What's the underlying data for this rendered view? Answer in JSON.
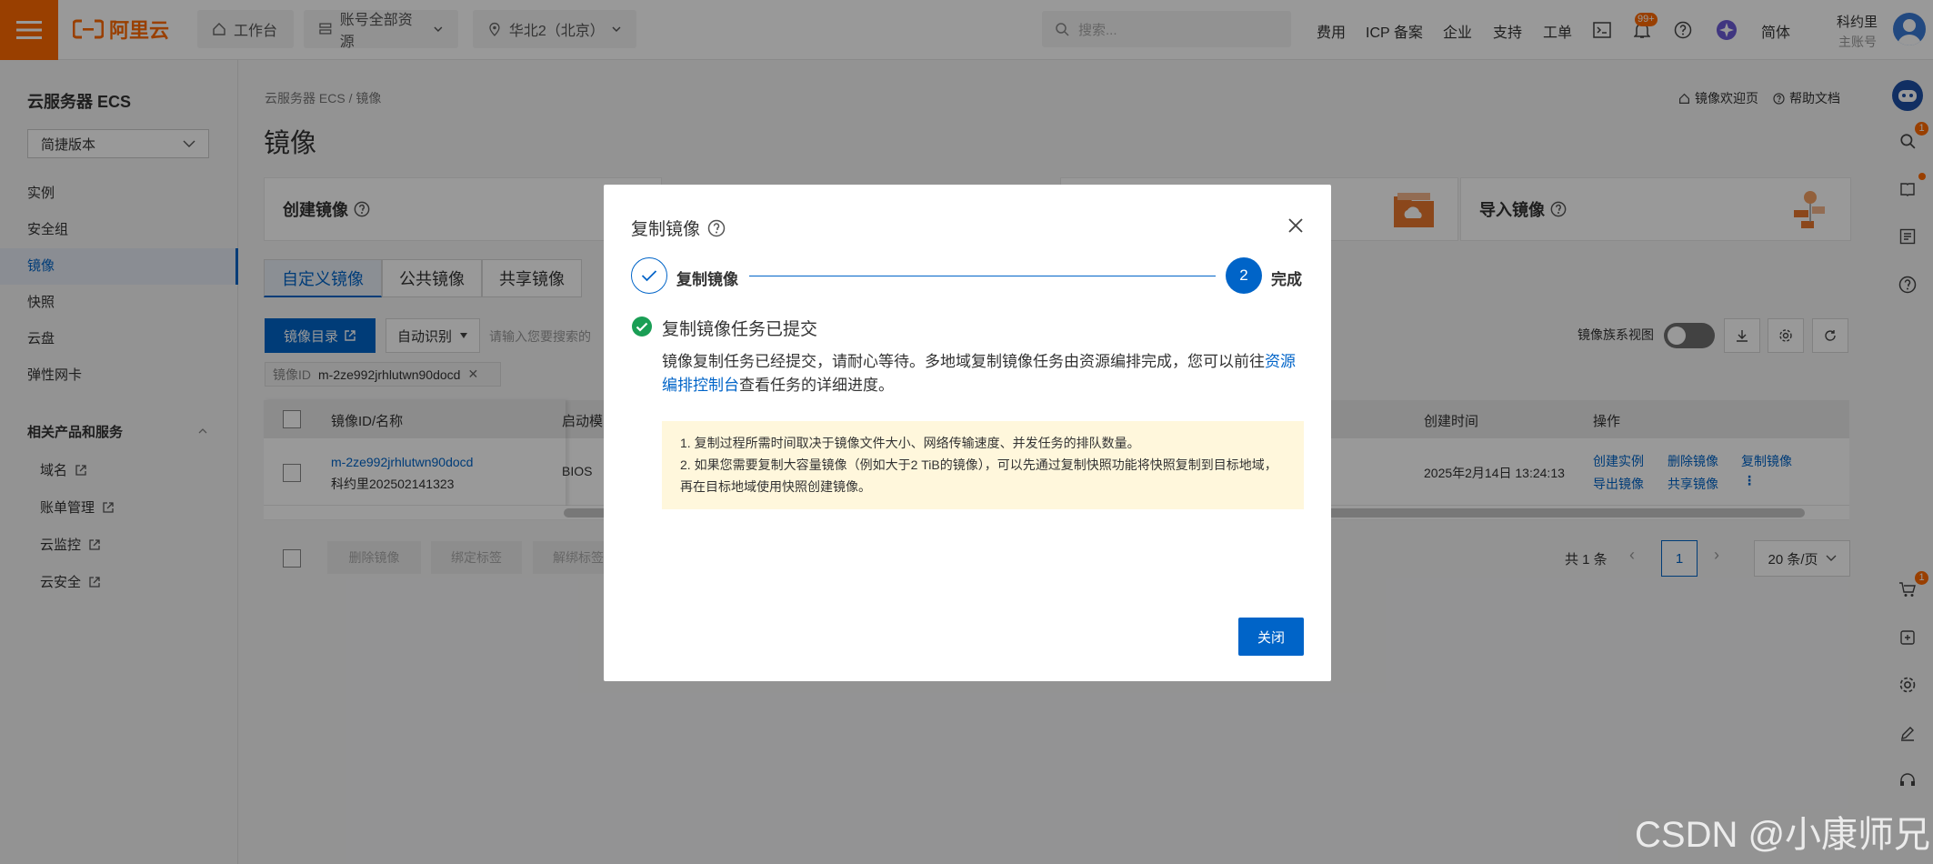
{
  "topbar": {
    "logo_text": "阿里云",
    "workbench": "工作台",
    "resources": "账号全部资源",
    "region": "华北2（北京）",
    "search_placeholder": "搜索...",
    "links": [
      "费用",
      "ICP 备案",
      "企业",
      "支持",
      "工单"
    ],
    "bell_badge": "99+",
    "lang": "简体",
    "user_name": "科约里",
    "user_role": "主账号"
  },
  "sidebar": {
    "title": "云服务器 ECS",
    "version": "简捷版本",
    "items": [
      "实例",
      "安全组",
      "镜像",
      "快照",
      "云盘",
      "弹性网卡"
    ],
    "active_item": "镜像",
    "related_title": "相关产品和服务",
    "related": [
      "域名",
      "账单管理",
      "云监控",
      "云安全"
    ]
  },
  "main": {
    "breadcrumb": "云服务器 ECS  /  镜像",
    "title": "镜像",
    "welcome_link": "镜像欢迎页",
    "help_link": "帮助文档",
    "card_create": "创建镜像",
    "card_import": "导入镜像",
    "tabs": [
      "自定义镜像",
      "公共镜像",
      "共享镜像"
    ],
    "catalog_btn": "镜像目录",
    "auto_detect": "自动识别",
    "search_placeholder": "请输入您要搜索的",
    "filter_key": "镜像ID",
    "filter_value": "m-2ze992jrhlutwn90docd",
    "family_view": "镜像族系视图",
    "columns": {
      "id_name": "镜像ID/名称",
      "boot_mode": "启动模",
      "created": "创建时间",
      "ops": "操作"
    },
    "row": {
      "id": "m-2ze992jrhlutwn90docd",
      "name": "科约里202502141323",
      "boot": "BIOS",
      "created": "2025年2月14日 13:24:13",
      "ops": [
        "创建实例",
        "删除镜像",
        "复制镜像",
        "导出镜像",
        "共享镜像"
      ]
    },
    "bulk": [
      "删除镜像",
      "绑定标签",
      "解绑标签"
    ],
    "total": "共 1 条",
    "page": "1",
    "page_size": "20 条/页"
  },
  "modal": {
    "title": "复制镜像",
    "step1": "复制镜像",
    "step2_num": "2",
    "step2": "完成",
    "heading": "复制镜像任务已提交",
    "desc_prefix": "镜像复制任务已经提交，请耐心等待。多地域复制镜像任务由资源编排完成，您可以前往",
    "desc_link": "资源编排控制台",
    "desc_suffix": "查看任务的详细进度。",
    "note1": "1. 复制过程所需时间取决于镜像文件大小、网络传输速度、并发任务的排队数量。",
    "note2": "2. 如果您需要复制大容量镜像（例如大于2 TiB的镜像），可以先通过复制快照功能将快照复制到目标地域，再在目标地域使用快照创建镜像。",
    "close_button": "关闭"
  },
  "rail": {
    "badge_search": "1",
    "badge_cart": "1"
  },
  "watermark": "CSDN @小康师兄",
  "colors": {
    "brand": "#ff6a00",
    "primary": "#0064c8",
    "success": "#1a9e55",
    "note_bg": "#fff7dc"
  }
}
